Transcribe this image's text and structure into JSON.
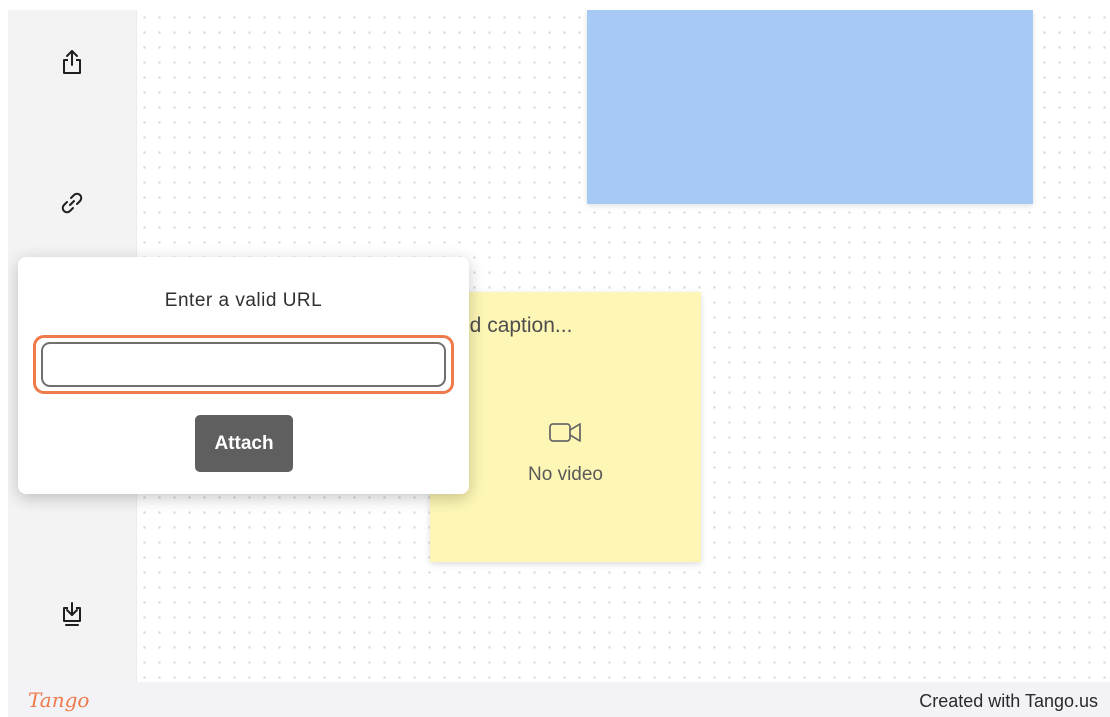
{
  "sidebar": {
    "items": [
      {
        "icon": "share-icon"
      },
      {
        "icon": "link-icon"
      },
      {
        "icon": "download-icon"
      }
    ]
  },
  "video_card": {
    "caption_placeholder": "dd caption...",
    "empty_label": "No video",
    "icon": "video-camera-icon"
  },
  "url_popup": {
    "title": "Enter a valid URL",
    "input_value": "",
    "input_placeholder": "",
    "attach_label": "Attach"
  },
  "footer": {
    "logo": "Tango",
    "credit": "Created with Tango.us"
  },
  "colors": {
    "highlight": "#ef7a4b",
    "blue_card": "#a6caf3",
    "yellow_card": "#fdf6b4",
    "attach_button": "#5f5f5f"
  }
}
